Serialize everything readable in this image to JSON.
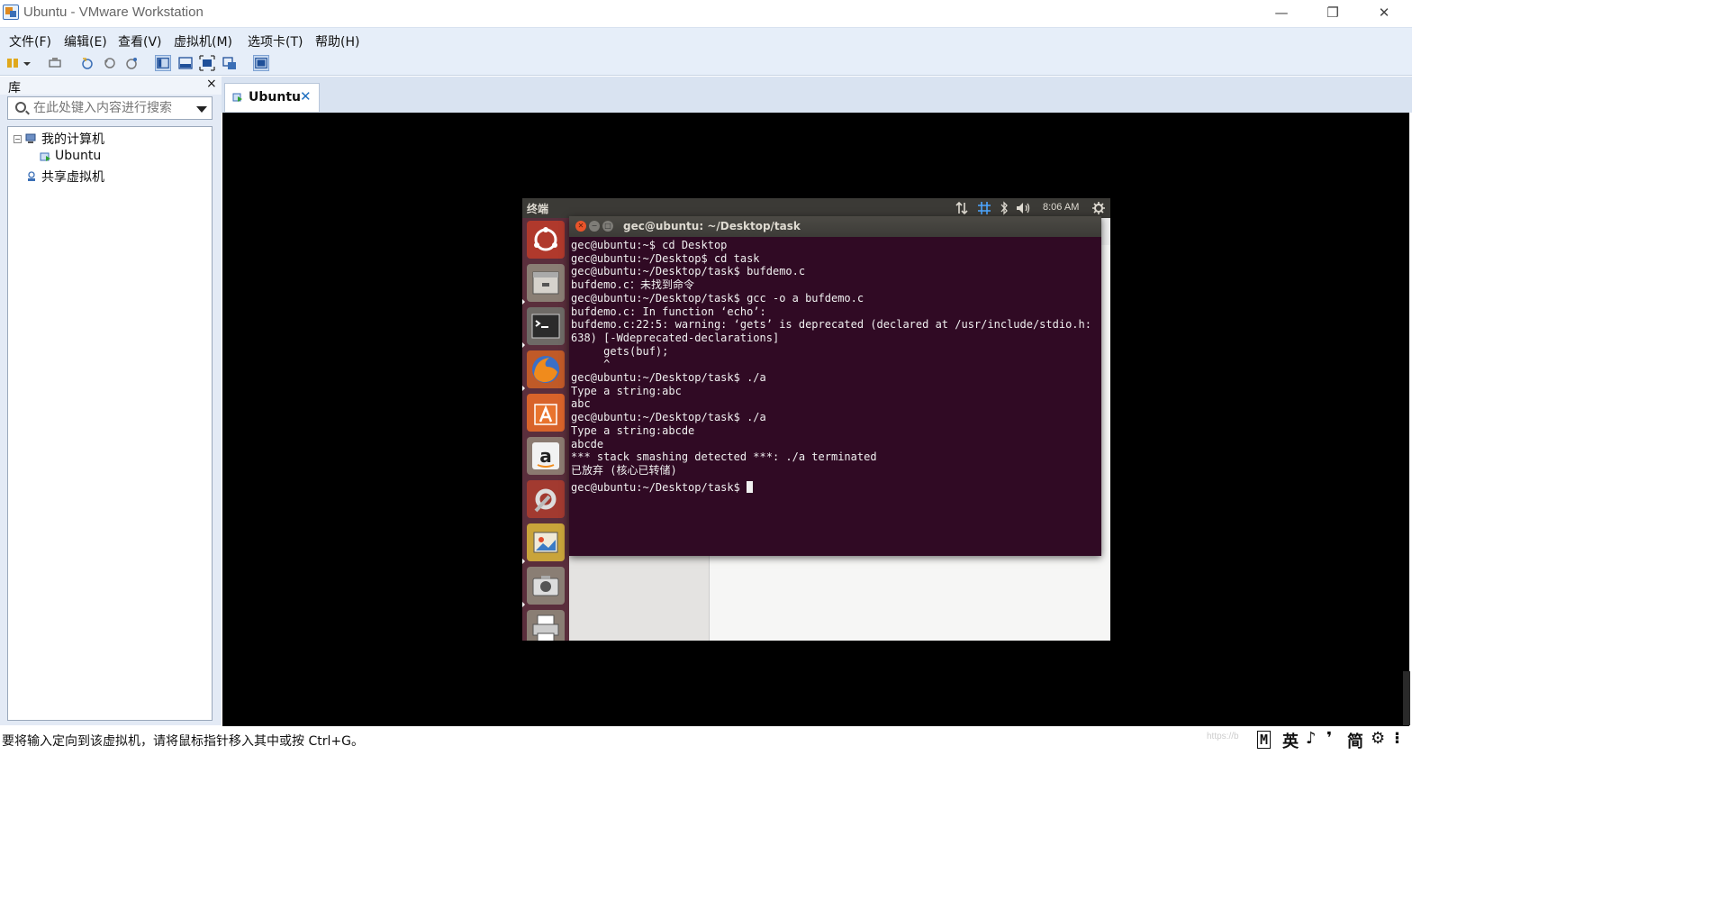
{
  "window": {
    "title": "Ubuntu - VMware Workstation",
    "minimize": "—",
    "maximize": "❐",
    "close": "✕"
  },
  "menu": {
    "items": [
      "文件(F)",
      "编辑(E)",
      "查看(V)",
      "虚拟机(M)",
      "选项卡(T)",
      "帮助(H)"
    ]
  },
  "library": {
    "title": "库",
    "close": "×",
    "search_placeholder": "在此处键入内容进行搜索",
    "tree": {
      "my_computer": "我的计算机",
      "vm_ubuntu": "Ubuntu",
      "shared_vms": "共享虚拟机",
      "toggle": "−"
    }
  },
  "tabs": [
    {
      "label": "Ubuntu",
      "close": "✕"
    }
  ],
  "ubuntu": {
    "panel": {
      "title": "终端",
      "time": "8:06 AM",
      "icons": [
        "network-icon",
        "keyboard-icon",
        "bluetooth-icon",
        "volume-icon",
        "gear-icon"
      ]
    },
    "launcher": [
      "ubuntu-dash-icon",
      "files-icon",
      "terminal-icon",
      "firefox-icon",
      "software-center-icon",
      "amazon-icon",
      "system-settings-icon",
      "image-viewer-icon",
      "camera-icon",
      "printer-icon"
    ],
    "terminal": {
      "title": "gec@ubuntu: ~/Desktop/task",
      "lines": [
        "gec@ubuntu:~$ cd Desktop",
        "gec@ubuntu:~/Desktop$ cd task",
        "gec@ubuntu:~/Desktop/task$ bufdemo.c",
        "bufdemo.c：未找到命令",
        "gec@ubuntu:~/Desktop/task$ gcc -o a bufdemo.c",
        "bufdemo.c: In function ‘echo’:",
        "bufdemo.c:22:5: warning: ‘gets’ is deprecated (declared at /usr/include/stdio.h:",
        "638) [-Wdeprecated-declarations]",
        "     gets(buf);",
        "     ^",
        "gec@ubuntu:~/Desktop/task$ ./a",
        "Type a string:abc",
        "abc",
        "gec@ubuntu:~/Desktop/task$ ./a",
        "Type a string:abcde",
        "abcde",
        "*** stack smashing detected ***: ./a terminated",
        "已放弃 (核心已转储)",
        "gec@ubuntu:~/Desktop/task$ "
      ]
    }
  },
  "status": {
    "text": "要将输入定向到该虚拟机，请将鼠标指针移入其中或按 Ctrl+G。",
    "watermark": "https://b"
  },
  "ime": {
    "items": [
      "M",
      "英",
      "♪",
      "❜",
      "简",
      "⚙",
      "⁝"
    ]
  },
  "colors": {
    "terminal_bg": "#300a24",
    "launcher_bg": "#5a2e3c",
    "panel_bg": "#3b3a36",
    "menubar_bg": "#e6eef9",
    "accent": "#1e6fc0"
  }
}
